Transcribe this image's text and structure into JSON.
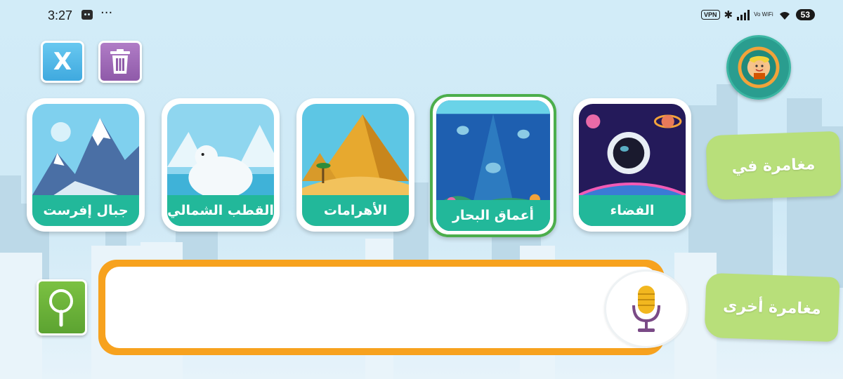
{
  "status_bar": {
    "time": "3:27",
    "more": "···",
    "vpn": "VPN",
    "vowifi": "Vo WiFi",
    "battery": "53"
  },
  "toolbar": {
    "close_label": "X"
  },
  "cards": [
    {
      "id": "everest",
      "label": "جبال إفرست"
    },
    {
      "id": "north-pole",
      "label": "القطب الشمالي"
    },
    {
      "id": "pyramids",
      "label": "الأهرامات"
    },
    {
      "id": "sea-depths",
      "label": "أعماق البحار",
      "selected": true
    },
    {
      "id": "space",
      "label": "الفضاء"
    }
  ],
  "side_buttons": {
    "adventure_in": "مغامرة في",
    "other_adventure": "مغامرة أخرى"
  },
  "input": {
    "value": "",
    "placeholder": ""
  },
  "icons": {
    "close": "close-icon",
    "trash": "trash-icon",
    "search": "search-icon",
    "mic": "microphone-icon"
  },
  "colors": {
    "accent_green": "#22b89a",
    "selected_border": "#4cae4c",
    "input_border": "#f7a21e",
    "tab_green": "#b8df7a"
  }
}
